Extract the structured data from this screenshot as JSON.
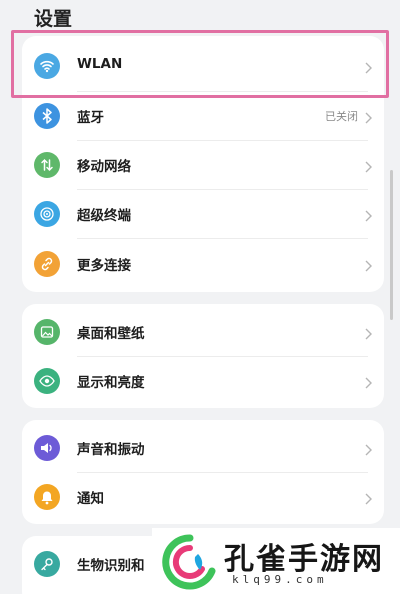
{
  "page": {
    "title": "设置"
  },
  "groups": [
    {
      "items": [
        {
          "id": "wlan",
          "label": "WLAN",
          "icon": "wifi-icon",
          "color": "#4aa8e3",
          "status": ""
        },
        {
          "id": "bluetooth",
          "label": "蓝牙",
          "icon": "bluetooth-icon",
          "color": "#3d93e0",
          "status": "已关闭"
        },
        {
          "id": "mobile-network",
          "label": "移动网络",
          "icon": "mobile-network-icon",
          "color": "#5fb86a",
          "status": ""
        },
        {
          "id": "super-device",
          "label": "超级终端",
          "icon": "super-device-icon",
          "color": "#3ba6e3",
          "status": ""
        },
        {
          "id": "more-connections",
          "label": "更多连接",
          "icon": "link-icon",
          "color": "#f2a236",
          "status": ""
        }
      ]
    },
    {
      "items": [
        {
          "id": "wallpaper",
          "label": "桌面和壁纸",
          "icon": "wallpaper-icon",
          "color": "#56b56a",
          "status": ""
        },
        {
          "id": "display",
          "label": "显示和亮度",
          "icon": "eye-icon",
          "color": "#3bb27f",
          "status": ""
        }
      ]
    },
    {
      "items": [
        {
          "id": "sound",
          "label": "声音和振动",
          "icon": "speaker-icon",
          "color": "#6d5bd7",
          "status": ""
        },
        {
          "id": "notifications",
          "label": "通知",
          "icon": "bell-icon",
          "color": "#f3a623",
          "status": ""
        }
      ]
    },
    {
      "items": [
        {
          "id": "biometrics",
          "label": "生物识别和",
          "icon": "key-icon",
          "color": "#38a9a0",
          "status": ""
        }
      ]
    }
  ],
  "watermark": {
    "text": "孔雀手游网",
    "url": "klq99.com"
  },
  "colors": {
    "highlight": "#e16fa2"
  }
}
